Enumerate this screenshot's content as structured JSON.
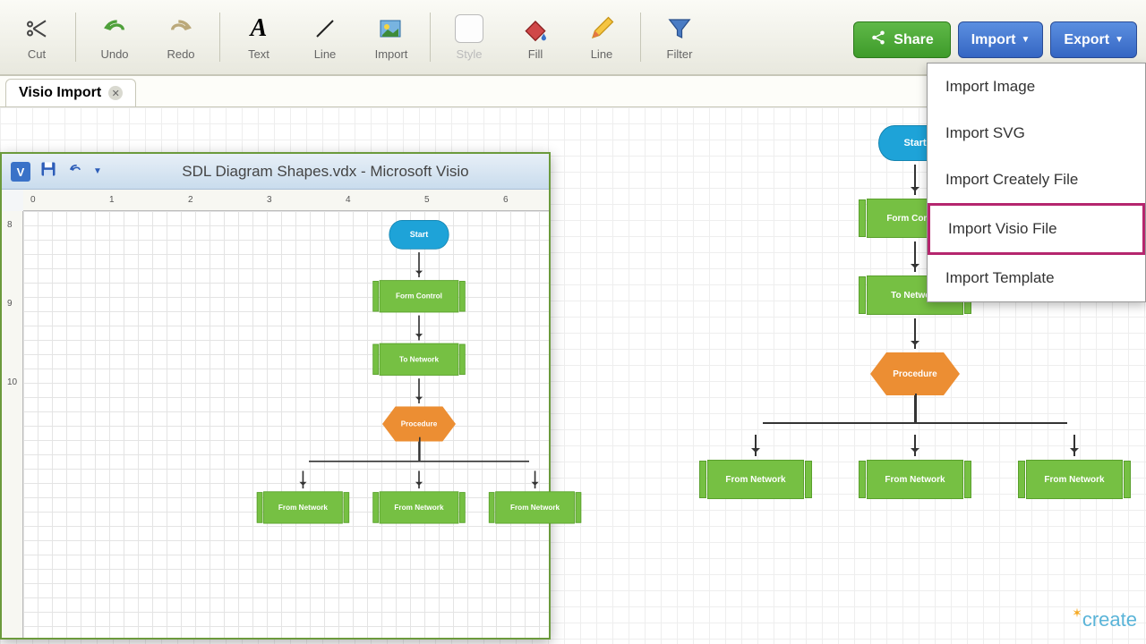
{
  "toolbar": {
    "cut": "Cut",
    "undo": "Undo",
    "redo": "Redo",
    "text": "Text",
    "line": "Line",
    "import": "Import",
    "style": "Style",
    "fill": "Fill",
    "line2": "Line",
    "filter": "Filter"
  },
  "buttons": {
    "share": "Share",
    "import": "Import",
    "export": "Export"
  },
  "tab": {
    "title": "Visio Import"
  },
  "dropdown": {
    "items": [
      "Import Image",
      "Import SVG",
      "Import Creately File",
      "Import Visio File",
      "Import Template"
    ],
    "highlighted_index": 3
  },
  "diagram": {
    "start": "Start",
    "form_control": "Form Control",
    "to_network": "To Network",
    "procedure": "Procedure",
    "from_network": "From Network"
  },
  "visio": {
    "title": "SDL Diagram Shapes.vdx  -  Microsoft Visio",
    "ruler_ticks": [
      "0",
      "1",
      "2",
      "3",
      "4",
      "5",
      "6"
    ]
  },
  "brand": "create"
}
